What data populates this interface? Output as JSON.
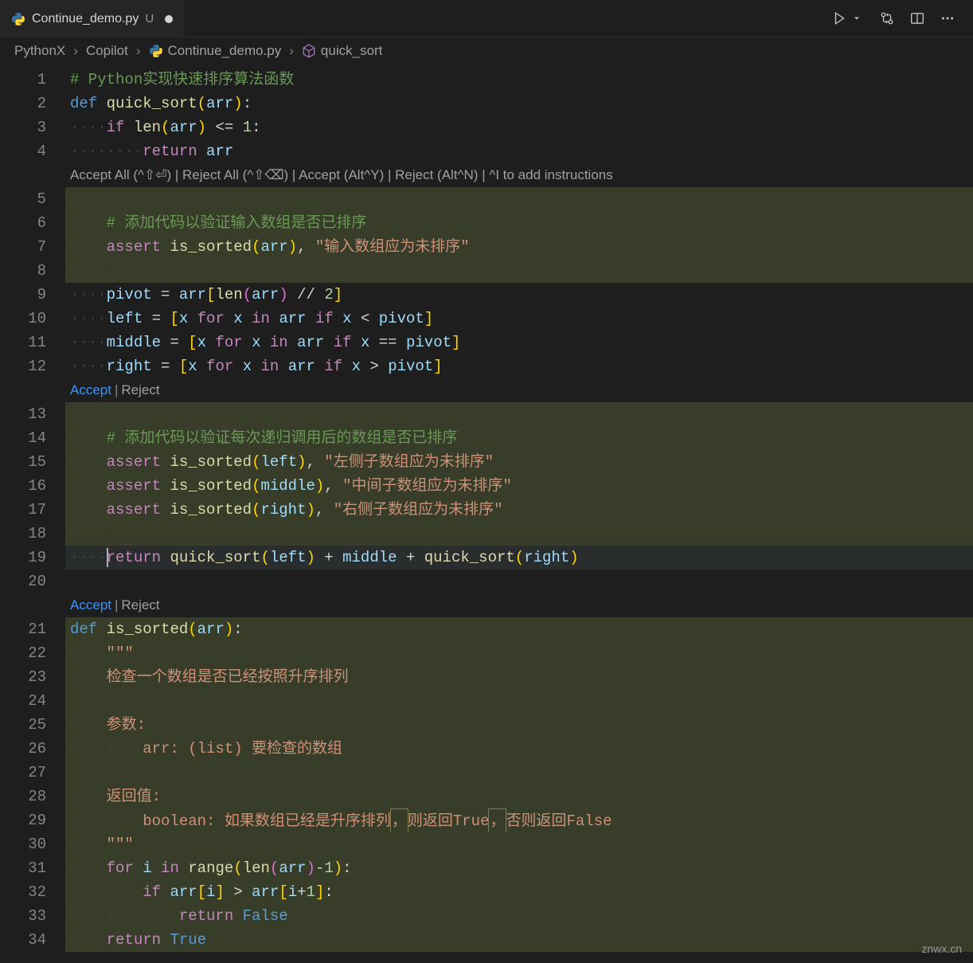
{
  "tab": {
    "name": "Continue_demo.py",
    "status": "U",
    "iconColors": [
      "#3776ab",
      "#ffd43b"
    ]
  },
  "toolbar": {
    "runLabel": "Run"
  },
  "breadcrumb": {
    "items": [
      "PythonX",
      "Copilot",
      "Continue_demo.py",
      "quick_sort"
    ]
  },
  "hints": {
    "main": "Accept All (^⇧⏎) | Reject All (^⇧⌫) | Accept (Alt^Y) | Reject (Alt^N) | ^I to add instructions",
    "acceptLabel": "Accept",
    "rejectLabel": "Reject",
    "sep": "|"
  },
  "lineNumbers": [
    "1",
    "2",
    "3",
    "4",
    "5",
    "6",
    "7",
    "8",
    "9",
    "10",
    "11",
    "12",
    "13",
    "14",
    "15",
    "16",
    "17",
    "18",
    "19",
    "20",
    "21",
    "22",
    "23",
    "24",
    "25",
    "26",
    "27",
    "28",
    "29",
    "30",
    "31",
    "32",
    "33",
    "34"
  ],
  "code": {
    "l1_comment": "# Python实现快速排序算法函数",
    "l2": {
      "def": "def",
      "name": "quick_sort",
      "arg": "arr"
    },
    "l3": {
      "if": "if",
      "len": "len",
      "arg": "arr",
      "op": "<=",
      "num": "1"
    },
    "l4": {
      "ret": "return",
      "var": "arr"
    },
    "l6_comment": "# 添加代码以验证输入数组是否已排序",
    "l7": {
      "assert": "assert",
      "fn": "is_sorted",
      "arg": "arr",
      "msg": "\"输入数组应为未排序\""
    },
    "l9": {
      "pivot": "pivot",
      "arr": "arr",
      "len": "len",
      "op": "//",
      "num": "2"
    },
    "l10": {
      "v": "left",
      "x": "x",
      "for": "for",
      "in": "in",
      "arr": "arr",
      "if": "if",
      "op": "<",
      "pivot": "pivot"
    },
    "l11": {
      "v": "middle",
      "x": "x",
      "for": "for",
      "in": "in",
      "arr": "arr",
      "if": "if",
      "op": "==",
      "pivot": "pivot"
    },
    "l12": {
      "v": "right",
      "x": "x",
      "for": "for",
      "in": "in",
      "arr": "arr",
      "if": "if",
      "op": ">",
      "pivot": "pivot"
    },
    "l14_comment": "# 添加代码以验证每次递归调用后的数组是否已排序",
    "l15": {
      "assert": "assert",
      "fn": "is_sorted",
      "arg": "left",
      "msg": "\"左侧子数组应为未排序\""
    },
    "l16": {
      "assert": "assert",
      "fn": "is_sorted",
      "arg": "middle",
      "msg": "\"中间子数组应为未排序\""
    },
    "l17": {
      "assert": "assert",
      "fn": "is_sorted",
      "arg": "right",
      "msg": "\"右侧子数组应为未排序\""
    },
    "l19": {
      "ret": "return",
      "fn": "quick_sort",
      "left": "left",
      "middle": "middle",
      "right": "right"
    },
    "l21": {
      "def": "def",
      "name": "is_sorted",
      "arg": "arr"
    },
    "l22_doc": "\"\"\"",
    "l23_doc": "检查一个数组是否已经按照升序排列",
    "l25_doc": "参数:",
    "l26_doc": "arr: (list) 要检查的数组",
    "l28_doc": "返回值:",
    "l29a": "boolean: 如果数组已经是升序排列",
    "l29b": "则返回True",
    "l29c": "否则返回False",
    "comma": "，",
    "l30_doc": "\"\"\"",
    "l31": {
      "for": "for",
      "i": "i",
      "in": "in",
      "range": "range",
      "len": "len",
      "arr": "arr",
      "minus": "-",
      "one": "1"
    },
    "l32": {
      "if": "if",
      "arr": "arr",
      "i": "i",
      "op": ">",
      "ip1": "i+1"
    },
    "l33": {
      "ret": "return",
      "val": "False"
    },
    "l34": {
      "ret": "return",
      "val": "True"
    }
  },
  "watermark": "znwx.cn"
}
